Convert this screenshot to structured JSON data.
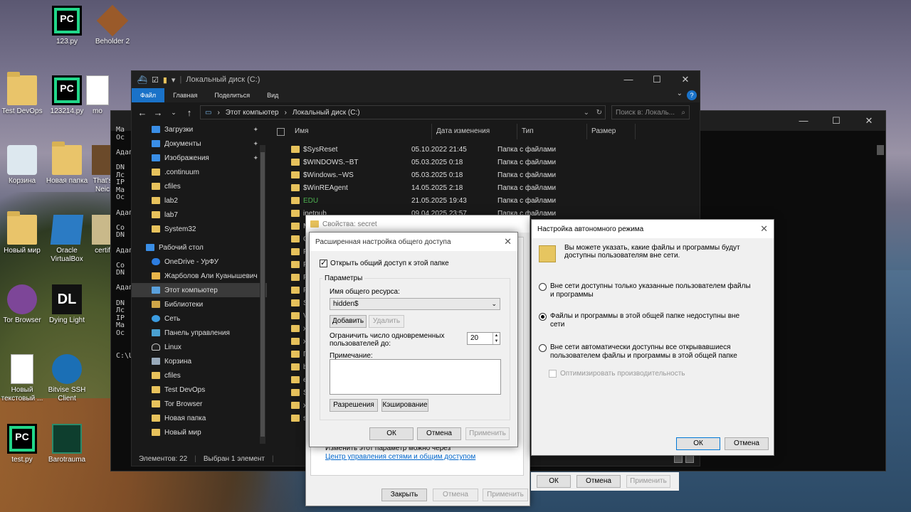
{
  "desktop": {
    "icons": [
      {
        "label": "123.py",
        "icon": "pycharm-icon"
      },
      {
        "label": "Beholder 2",
        "icon": "beholder-icon"
      },
      {
        "label": "Test DevOps",
        "icon": "folder-icon"
      },
      {
        "label": "123214.py",
        "icon": "pycharm-icon"
      },
      {
        "label": "mo",
        "icon": "document-icon"
      },
      {
        "label": "Корзина",
        "icon": "recycle-bin-icon"
      },
      {
        "label": "Новая папка",
        "icon": "folder-icon"
      },
      {
        "label": "That's",
        "icon": "game-icon"
      },
      {
        "label": "Neic",
        "icon": "game-icon"
      },
      {
        "label": "Новый мир",
        "icon": "folder-icon"
      },
      {
        "label": "Oracle VirtualBox",
        "icon": "virtualbox-icon"
      },
      {
        "label": "certif",
        "icon": "document-icon"
      },
      {
        "label": "Tor Browser",
        "icon": "tor-icon"
      },
      {
        "label": "Dying Light",
        "icon": "dying-light-icon"
      },
      {
        "label": "Новый текстовый ...",
        "icon": "text-file-icon"
      },
      {
        "label": "Bitvise SSH Client",
        "icon": "bitvise-icon"
      },
      {
        "label": "test.py",
        "icon": "pycharm-icon"
      },
      {
        "label": "Barotrauma",
        "icon": "barotrauma-icon"
      }
    ]
  },
  "terminal": {
    "lines": [
      "Ma",
      "Oc",
      "",
      "Адапт",
      "",
      "DN",
      "Лс",
      "IP",
      "Ma",
      "Oc",
      "",
      "Адапт",
      "",
      "Co",
      "DN",
      "",
      "Адапт",
      "",
      "Co",
      "DN",
      "",
      "Адапт",
      "",
      "DN",
      "Лс",
      "IP",
      "Ma",
      "Oc",
      "",
      "",
      "C:\\Us"
    ]
  },
  "explorer": {
    "title": "Локальный диск (C:)",
    "ribbon_tabs": [
      "Файл",
      "Главная",
      "Поделиться",
      "Вид"
    ],
    "path": [
      "Этот компьютер",
      "Локальный диск (C:)"
    ],
    "search_placeholder": "Поиск в: Локаль...",
    "nav_items": [
      {
        "label": "Загрузки",
        "icon": "download",
        "pinned": true
      },
      {
        "label": "Документы",
        "icon": "doc",
        "pinned": true
      },
      {
        "label": "Изображения",
        "icon": "img",
        "pinned": true
      },
      {
        "label": ".continuum",
        "icon": "fold"
      },
      {
        "label": "cfiles",
        "icon": "fold"
      },
      {
        "label": "lab2",
        "icon": "fold"
      },
      {
        "label": "lab7",
        "icon": "fold"
      },
      {
        "label": "System32",
        "icon": "fold"
      },
      {
        "label": "Рабочий стол",
        "icon": "desktop",
        "top": true
      },
      {
        "label": "OneDrive - УрФУ",
        "icon": "cloud"
      },
      {
        "label": "Жарболов Али Куанышевич",
        "icon": "user"
      },
      {
        "label": "Этот компьютер",
        "icon": "pc",
        "selected": true
      },
      {
        "label": "Библиотеки",
        "icon": "lib"
      },
      {
        "label": "Сеть",
        "icon": "net"
      },
      {
        "label": "Панель управления",
        "icon": "panel"
      },
      {
        "label": "Linux",
        "icon": "linux"
      },
      {
        "label": "Корзина",
        "icon": "trash"
      },
      {
        "label": "cfiles",
        "icon": "fold"
      },
      {
        "label": "Test DevOps",
        "icon": "fold"
      },
      {
        "label": "Tor Browser",
        "icon": "fold"
      },
      {
        "label": "Новая папка",
        "icon": "fold"
      },
      {
        "label": "Новый мир",
        "icon": "fold"
      }
    ],
    "columns": [
      "Имя",
      "Дата изменения",
      "Тип",
      "Размер"
    ],
    "files": [
      {
        "name": "$SysReset",
        "date": "05.10.2022 21:45",
        "type": "Папка с файлами"
      },
      {
        "name": "$WINDOWS.~BT",
        "date": "05.03.2025 0:18",
        "type": "Папка с файлами"
      },
      {
        "name": "$Windows.~WS",
        "date": "05.03.2025 0:18",
        "type": "Папка с файлами"
      },
      {
        "name": "$WinREAgent",
        "date": "14.05.2025 2:18",
        "type": "Папка с файлами"
      },
      {
        "name": "EDU",
        "date": "21.05.2025 19:43",
        "type": "Папка с файлами",
        "green": true
      },
      {
        "name": "inetpub",
        "date": "09.04.2025 23:57",
        "type": "Папка с файлами"
      }
    ],
    "partial_files": [
      "M",
      "O",
      "P",
      "P",
      "P",
      "P",
      "S",
      "V",
      "x",
      "x",
      "П",
      "b",
      "e",
      "S",
      "x",
      "s"
    ],
    "status_count": "Элементов: 22",
    "status_selected": "Выбран 1 элемент"
  },
  "properties": {
    "title": "Свойства: secret",
    "note_text": "Изменить этот параметр можно через ",
    "note_link": "Центр управления сетями и общим доступом",
    "close_label": "Закрыть",
    "cancel_label": "Отмена",
    "apply_label": "Применить"
  },
  "props_behind": {
    "ok_label": "ОК",
    "cancel_label": "Отмена",
    "apply_label": "Применить"
  },
  "advanced_sharing": {
    "title": "Расширенная настройка общего доступа",
    "share_checkbox_label": "Открыть общий доступ к этой папке",
    "share_checked": true,
    "group_label": "Параметры",
    "share_name_label": "Имя общего ресурса:",
    "share_name_value": "hidden$",
    "add_label": "Добавить",
    "remove_label": "Удалить",
    "limit_label": "Ограничить число одновременных пользователей до:",
    "limit_value": "20",
    "comment_label": "Примечание:",
    "permissions_label": "Разрешения",
    "caching_label": "Кэширование",
    "ok_label": "ОК",
    "cancel_label": "Отмена",
    "apply_label": "Применить"
  },
  "offline_settings": {
    "title": "Настройка автономного режима",
    "intro": "Вы можете указать, какие файлы и программы будут доступны пользователям вне сети.",
    "option1": "Вне сети доступны только указанные пользователем файлы и программы",
    "option2": "Файлы и программы в этой общей папке недоступны вне сети",
    "option3": "Вне сети автоматически доступны все открывавшиеся пользователем файлы и программы в этой общей папке",
    "optimize_label": "Оптимизировать производительность",
    "selected_option": 2,
    "ok_label": "ОК",
    "cancel_label": "Отмена"
  }
}
